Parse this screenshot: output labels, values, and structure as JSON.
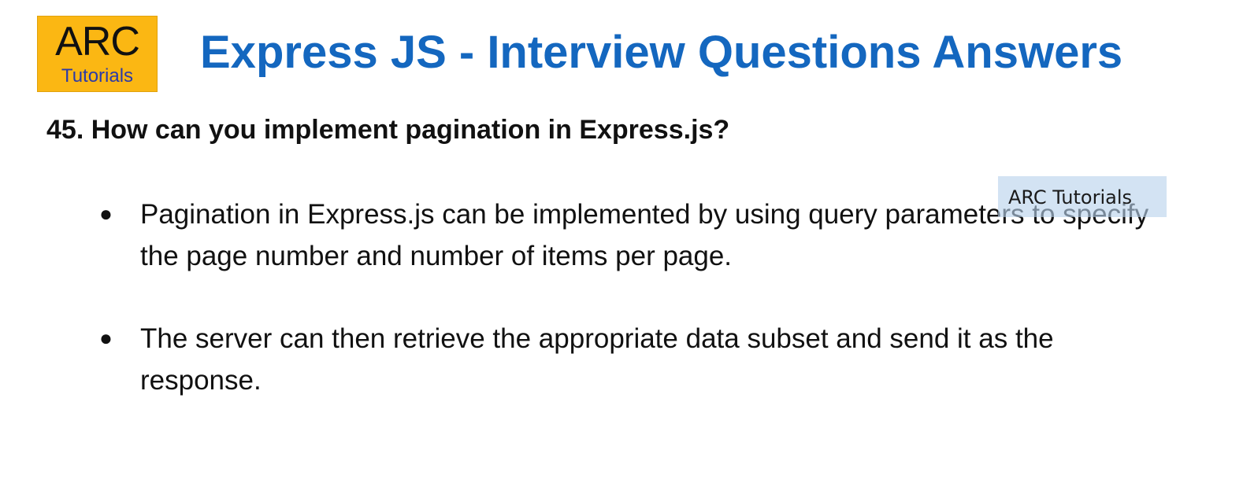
{
  "logo": {
    "main": "ARC",
    "sub": "Tutorials"
  },
  "header": {
    "title": "Express JS - Interview Questions Answers"
  },
  "question": {
    "text": "45. How can you implement pagination in Express.js?"
  },
  "bullets": [
    {
      "text": "Pagination in Express.js can be implemented by using query parameters to specify the page number and number of items per page."
    },
    {
      "text": "The server can then retrieve the appropriate data subset and send it as the response."
    }
  ],
  "watermark": {
    "text": "ARC Tutorials"
  },
  "colors": {
    "title": "#1467bf",
    "logo_background": "#fbb713",
    "logo_sub": "#2b3aa8",
    "watermark_background": "#b8d2eb"
  }
}
